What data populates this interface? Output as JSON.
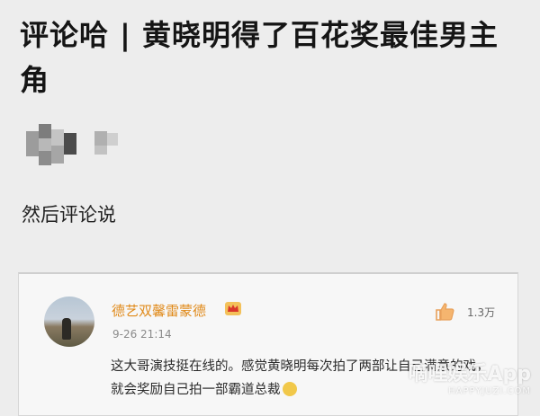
{
  "article": {
    "title": "评论哈 | 黄晓明得了百花奖最佳男主角",
    "body_text": "然后评论说"
  },
  "comment": {
    "username": "德艺双馨雷蒙德",
    "timestamp": "9-26 21:14",
    "like_count": "1.3万",
    "text": "这大哥演技挺在线的。感觉黄晓明每次拍了两部让自己满意的戏，就会奖励自己拍一部霸道总裁",
    "icons": [
      "avatar",
      "crown-icon",
      "thumbs-up-icon",
      "emoji-icon"
    ]
  },
  "watermark": {
    "main": "嘀哩娱乐App",
    "sub": "HAPPYJUZI.COM"
  },
  "colors": {
    "background": "#ededed",
    "username": "#e08a1a",
    "like_icon": "#e8a05a"
  }
}
